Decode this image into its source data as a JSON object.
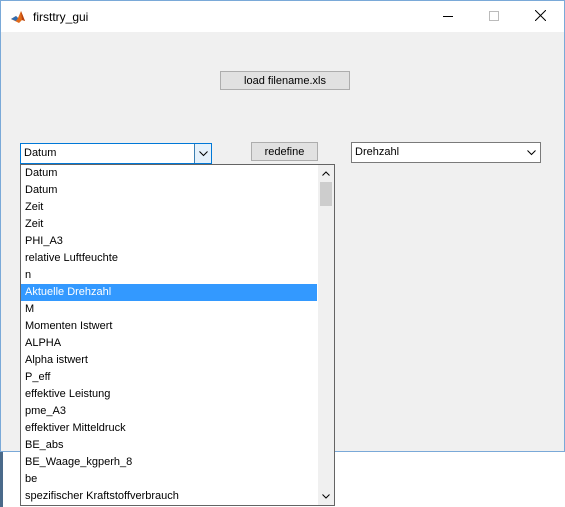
{
  "window": {
    "title": "firsttry_gui"
  },
  "buttons": {
    "load_label": "load filename.xls",
    "redefine_label": "redefine"
  },
  "combo_left": {
    "selected": "Datum"
  },
  "combo_right": {
    "selected": "Drehzahl"
  },
  "dropdown": {
    "items": [
      "Datum",
      "Datum",
      "Zeit",
      "Zeit",
      "PHI_A3",
      "relative Luftfeuchte",
      "n",
      "Aktuelle Drehzahl",
      "M",
      "Momenten Istwert",
      "ALPHA",
      "Alpha istwert",
      "P_eff",
      "effektive Leistung",
      "pme_A3",
      "effektiver Mitteldruck",
      "BE_abs",
      "BE_Waage_kgperh_8",
      "be",
      "spezifischer Kraftstoffverbrauch"
    ],
    "highlighted_index": 7
  },
  "icons": {
    "app": "matlab-logo-icon",
    "minimize": "minimize-icon",
    "maximize": "maximize-icon",
    "close": "close-icon",
    "combo_arrow": "chevron-down-icon",
    "scroll_up": "scroll-up-icon",
    "scroll_down": "scroll-down-icon"
  },
  "colors": {
    "selection": "#3399ff",
    "window_bg": "#f0f0f0",
    "focus_border": "#0078d7"
  }
}
